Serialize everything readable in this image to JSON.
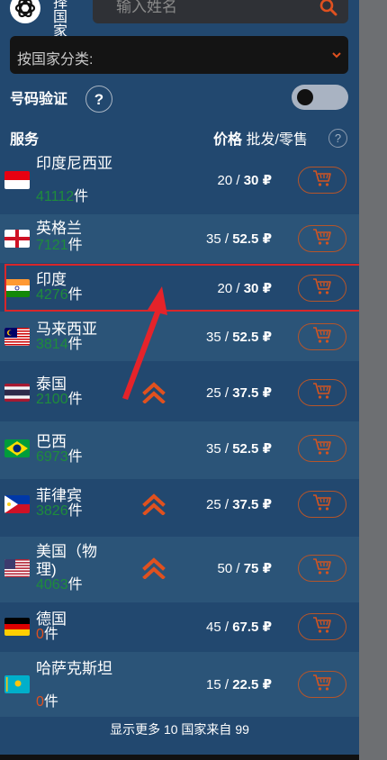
{
  "header": {
    "logo_label": "择国家",
    "search_placeholder": "输入姓名"
  },
  "filter": {
    "label": "按国家分类:"
  },
  "verify": {
    "label": "号码验证",
    "help": "?"
  },
  "table": {
    "service_label": "服务",
    "price_label": "价格",
    "price_mode": "批发/零售",
    "help": "?"
  },
  "rows": [
    {
      "name": "印度尼西亚",
      "count": "41112",
      "unit": "件",
      "wholesale": "20",
      "retail": "30",
      "currency": "₽",
      "flag": "indonesia"
    },
    {
      "name": "英格兰",
      "count": "7121",
      "unit": "件",
      "wholesale": "35",
      "retail": "52.5",
      "currency": "₽",
      "flag": "england"
    },
    {
      "name": "印度",
      "count": "4276",
      "unit": "件",
      "wholesale": "20",
      "retail": "30",
      "currency": "₽",
      "flag": "india"
    },
    {
      "name": "马来西亚",
      "count": "3814",
      "unit": "件",
      "wholesale": "35",
      "retail": "52.5",
      "currency": "₽",
      "flag": "malaysia"
    },
    {
      "name": "泰国",
      "count": "2100",
      "unit": "件",
      "wholesale": "25",
      "retail": "37.5",
      "currency": "₽",
      "flag": "thailand",
      "hot": true
    },
    {
      "name": "巴西",
      "count": "6973",
      "unit": "件",
      "wholesale": "35",
      "retail": "52.5",
      "currency": "₽",
      "flag": "brazil"
    },
    {
      "name": "菲律宾",
      "count": "3826",
      "unit": "件",
      "wholesale": "25",
      "retail": "37.5",
      "currency": "₽",
      "flag": "philippines",
      "hot": true
    },
    {
      "name": "美国（物理)",
      "count": "4063",
      "unit": "件",
      "wholesale": "50",
      "retail": "75",
      "currency": "₽",
      "flag": "usa",
      "hot": true
    },
    {
      "name": "德国",
      "count": "0",
      "unit": "件",
      "wholesale": "45",
      "retail": "67.5",
      "currency": "₽",
      "flag": "germany"
    },
    {
      "name": "哈萨克斯坦",
      "count": "0",
      "unit": "件",
      "wholesale": "15",
      "retail": "22.5",
      "currency": "₽",
      "flag": "kazakhstan"
    }
  ],
  "footer": {
    "text": "显示更多 10 国家来自 99"
  },
  "colors": {
    "panel": "#22486f",
    "alt_row": "#2b5478",
    "accent": "#e0511f",
    "count_green": "#1e8c3c",
    "highlight": "#d9262a"
  }
}
